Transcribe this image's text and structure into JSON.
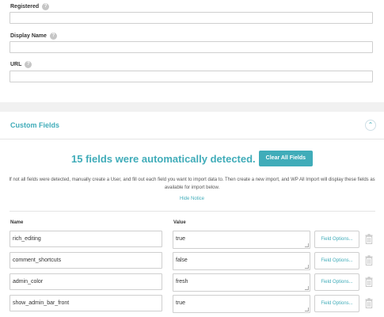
{
  "fields": {
    "registered_label": "Registered",
    "display_name_label": "Display Name",
    "url_label": "URL",
    "help_glyph": "?"
  },
  "custom_fields": {
    "title": "Custom Fields",
    "collapse_glyph": "⌃",
    "detected_text": "15 fields were automatically detected.",
    "clear_all_label": "Clear All Fields",
    "notice_text": "If not all fields were detected, manually create a User, and fill out each field you want to import data to. Then create a new import, and WP All Import will display these fields as available for import below.",
    "hide_notice_label": "Hide Notice",
    "column_name": "Name",
    "column_value": "Value",
    "options_label": "Field Options...",
    "rows": [
      {
        "name": "rich_editing",
        "value": "true"
      },
      {
        "name": "comment_shortcuts",
        "value": "false"
      },
      {
        "name": "admin_color",
        "value": "fresh"
      },
      {
        "name": "show_admin_bar_front",
        "value": "true"
      }
    ]
  },
  "colors": {
    "accent": "#40acb9",
    "background": "#f1f1f1",
    "panel": "#ffffff"
  }
}
